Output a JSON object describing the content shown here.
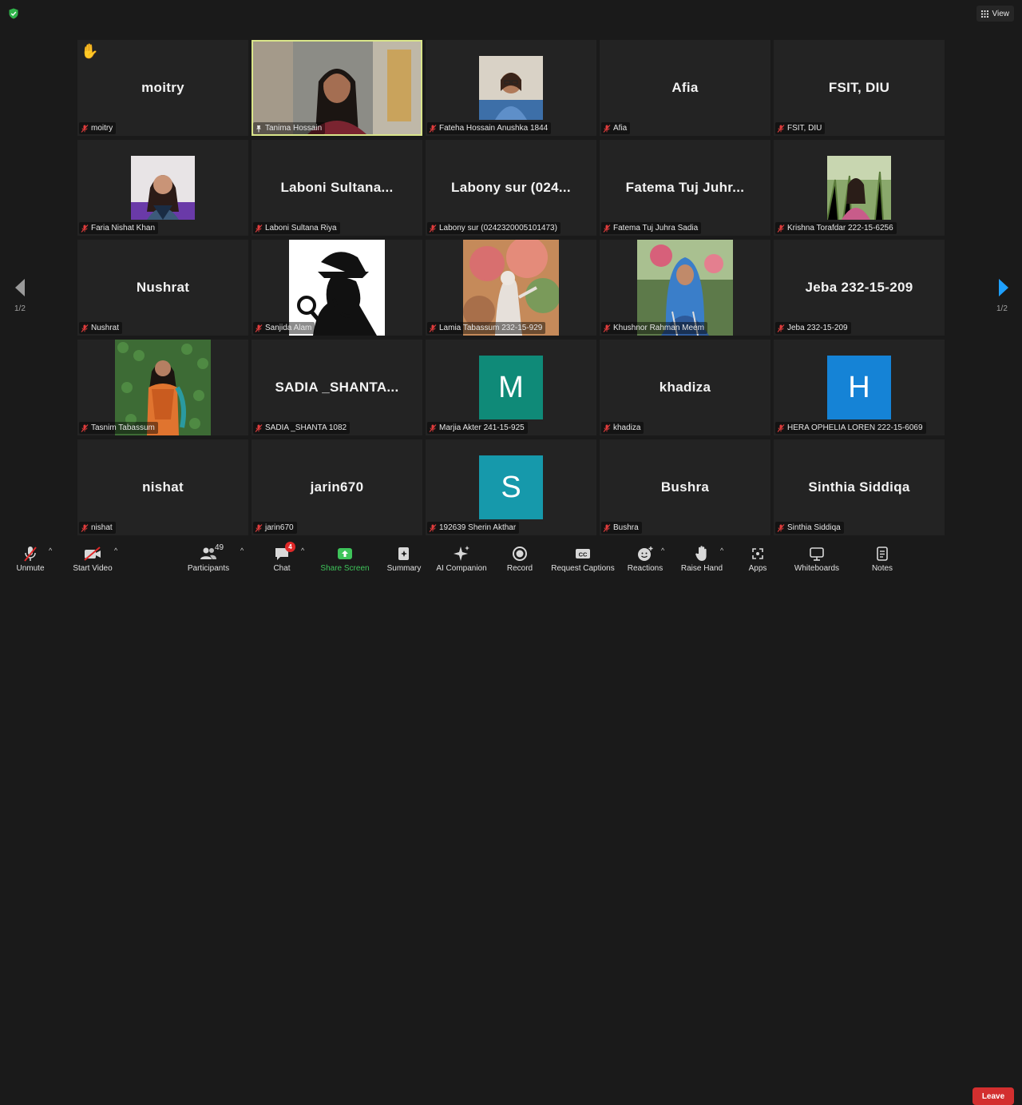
{
  "view_label": "View",
  "page_left": "1/2",
  "page_right": "1/2",
  "accent": "#d9e58a",
  "tiles": [
    {
      "display": "moitry",
      "label": "moitry",
      "kind": "text",
      "hand": true
    },
    {
      "display": "",
      "label": "Tanima Hossain",
      "kind": "video-active"
    },
    {
      "display": "",
      "label": "Fateha Hossain Anushka 1844",
      "kind": "photo",
      "scene": "glasses-woman"
    },
    {
      "display": "Afia",
      "label": "Afia",
      "kind": "text"
    },
    {
      "display": "FSIT, DIU",
      "label": "FSIT, DIU",
      "kind": "text"
    },
    {
      "display": "",
      "label": "Faria Nishat Khan",
      "kind": "photo",
      "scene": "purple-woman"
    },
    {
      "display": "Laboni  Sultana...",
      "label": "Laboni Sultana Riya",
      "kind": "text"
    },
    {
      "display": "Labony  sur  (024...",
      "label": "Labony sur (0242320005101473)",
      "kind": "text"
    },
    {
      "display": "Fatema  Tuj  Juhr...",
      "label": "Fatema Tuj Juhra Sadia",
      "kind": "text"
    },
    {
      "display": "",
      "label": "Krishna Torafdar 222-15-6256",
      "kind": "photo",
      "scene": "field-woman"
    },
    {
      "display": "Nushrat",
      "label": "Nushrat",
      "kind": "text"
    },
    {
      "display": "",
      "label": "Sanjida Alam",
      "kind": "photo-full",
      "scene": "detective"
    },
    {
      "display": "",
      "label": "Lamia Tabassum 232-15-929",
      "kind": "photo-full",
      "scene": "flowers"
    },
    {
      "display": "",
      "label": "Khushnor Rahman Meem",
      "kind": "photo-full",
      "scene": "hijab"
    },
    {
      "display": "Jeba 232-15-209",
      "label": "Jeba 232-15-209",
      "kind": "text"
    },
    {
      "display": "",
      "label": "Tasnim Tabassum",
      "kind": "photo-full",
      "scene": "green-wall"
    },
    {
      "display": "SADIA  _SHANTA...",
      "label": "SADIA _SHANTA 1082",
      "kind": "text"
    },
    {
      "display": "M",
      "label": "Marjia Akter 241-15-925",
      "kind": "avatar",
      "color": "#0f8a78"
    },
    {
      "display": "khadiza",
      "label": "khadiza",
      "kind": "text"
    },
    {
      "display": "H",
      "label": "HERA OPHELIA LOREN 222-15-6069",
      "kind": "avatar",
      "color": "#1583d6"
    },
    {
      "display": "nishat",
      "label": "nishat",
      "kind": "text"
    },
    {
      "display": "jarin670",
      "label": "jarin670",
      "kind": "text"
    },
    {
      "display": "S",
      "label": "192639 Sherin Akthar",
      "kind": "avatar",
      "color": "#1699ab"
    },
    {
      "display": "Bushra",
      "label": "Bushra",
      "kind": "text"
    },
    {
      "display": "Sinthia Siddiqa",
      "label": "Sinthia Siddiqa",
      "kind": "text"
    }
  ],
  "toolbar": {
    "unmute": "Unmute",
    "start_video": "Start Video",
    "participants": "Participants",
    "participant_count": "49",
    "chat": "Chat",
    "chat_badge": "4",
    "share_screen": "Share Screen",
    "summary": "Summary",
    "ai_companion": "AI Companion",
    "record": "Record",
    "request_captions": "Request Captions",
    "reactions": "Reactions",
    "raise_hand": "Raise Hand",
    "apps": "Apps",
    "whiteboards": "Whiteboards",
    "notes": "Notes",
    "leave": "Leave"
  },
  "icons": [
    "shield-icon",
    "grid-view-icon",
    "mic-off-icon",
    "video-off-icon",
    "participants-icon",
    "chat-icon",
    "share-screen-icon",
    "summary-icon",
    "sparkle-icon",
    "record-icon",
    "captions-icon",
    "reactions-icon",
    "raise-hand-icon",
    "apps-icon",
    "whiteboard-icon",
    "notes-icon",
    "chevron-left-icon",
    "chevron-right-icon"
  ]
}
